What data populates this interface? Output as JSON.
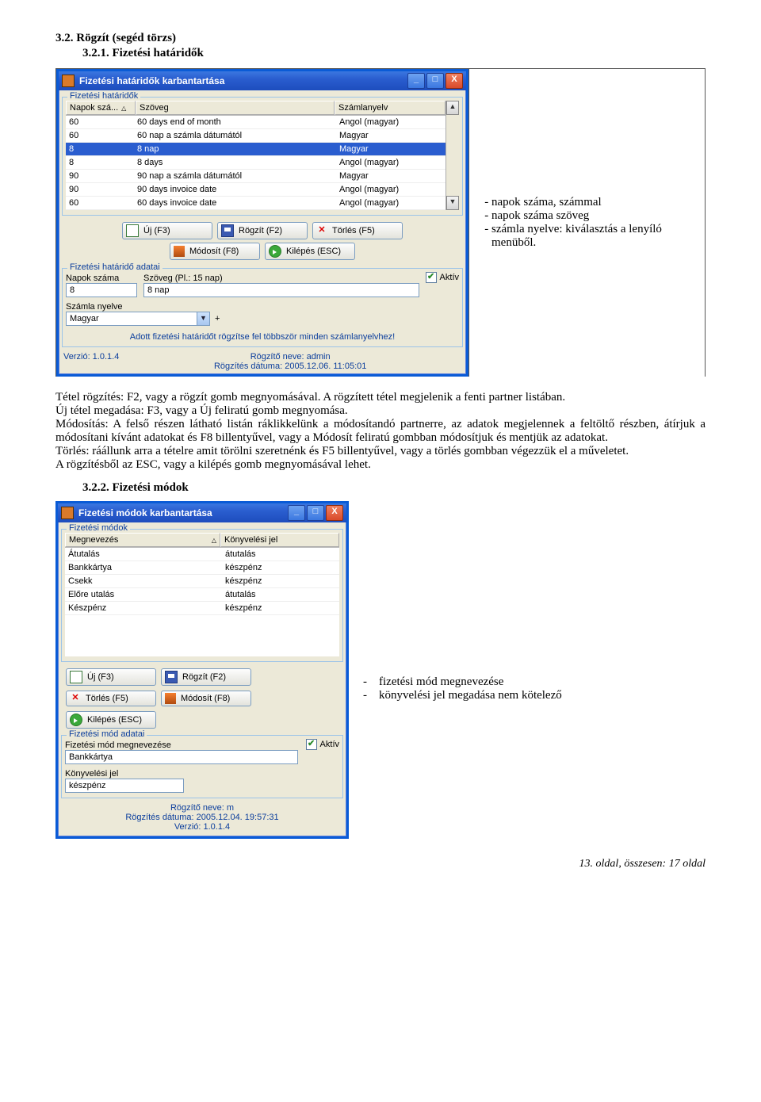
{
  "headings": {
    "h1": "3.2. Rögzít (segéd törzs)",
    "h2": "3.2.1. Fizetési határidők",
    "h3": "3.2.2. Fizetési módok"
  },
  "win1": {
    "title": "Fizetési határidők karbantartása",
    "group1": "Fizetési határidők",
    "columns": {
      "c1": "Napok szá...",
      "c2": "Szöveg",
      "c3": "Számlanyelv"
    },
    "rows": [
      {
        "c1": "60",
        "c2": "60 days end of month",
        "c3": "Angol (magyar)"
      },
      {
        "c1": "60",
        "c2": "60 nap a számla dátumától",
        "c3": "Magyar"
      },
      {
        "c1": "8",
        "c2": "8 nap",
        "c3": "Magyar",
        "sel": true
      },
      {
        "c1": "8",
        "c2": "8 days",
        "c3": "Angol (magyar)"
      },
      {
        "c1": "90",
        "c2": "90 nap a számla dátumától",
        "c3": "Magyar"
      },
      {
        "c1": "90",
        "c2": "90 days invoice date",
        "c3": "Angol (magyar)"
      },
      {
        "c1": "60",
        "c2": "60 days invoice date",
        "c3": "Angol (magyar)"
      }
    ],
    "buttons": {
      "new": "Új (F3)",
      "save": "Rögzít (F2)",
      "del": "Törlés (F5)",
      "edit": "Módosít (F8)",
      "exit": "Kilépés (ESC)"
    },
    "group2": "Fizetési határidő adatai",
    "labels": {
      "napok": "Napok száma",
      "szoveg": "Szöveg",
      "szoveg_hint": "(Pl.: 15 nap)",
      "aktiv": "Aktív",
      "nyelv": "Számla nyelve"
    },
    "values": {
      "napok": "8",
      "szoveg": "8 nap",
      "nyelv": "Magyar",
      "plus": "+"
    },
    "note": "Adott fizetési határidőt rögzítse fel többször minden számlanyelvhez!",
    "status": {
      "version": "Verzió: 1.0.1.4",
      "user": "Rögzítő neve: admin",
      "date": "Rögzítés dátuma: 2005.12.06. 11:05:01"
    }
  },
  "side1": {
    "i1": "napok száma, számmal",
    "i2": "napok száma szöveg",
    "i3": "számla nyelve: kiválasztás a lenyíló menüből."
  },
  "para": {
    "p1": "Tétel rögzítés: F2, vagy a rögzít gomb megnyomásával. A rögzített tétel megjelenik a fenti partner listában.",
    "p2": "Új tétel megadása: F3, vagy a Új feliratú gomb megnyomása.",
    "p3": "Módosítás: A felső részen látható listán ráklikkelünk a módosítandó partnerre, az adatok megjelennek a feltöltő részben, átírjuk a módosítani kívánt adatokat és F8 billentyűvel, vagy a Módosít feliratú gombban módosítjuk és mentjük az adatokat.",
    "p4": "Törlés: ráállunk arra a tételre amit törölni szeretnénk és F5 billentyűvel, vagy a törlés gombban végezzük el a műveletet.",
    "p5": "A rögzítésből az ESC, vagy a kilépés gomb megnyomásával lehet."
  },
  "win2": {
    "title": "Fizetési módok karbantartása",
    "group1": "Fizetési módok",
    "columns": {
      "c1": "Megnevezés",
      "c2": "Könyvelési jel"
    },
    "rows": [
      {
        "c1": "Átutalás",
        "c2": "átutalás"
      },
      {
        "c1": "Bankkártya",
        "c2": "készpénz"
      },
      {
        "c1": "Csekk",
        "c2": "készpénz"
      },
      {
        "c1": "Előre utalás",
        "c2": "átutalás"
      },
      {
        "c1": "Készpénz",
        "c2": "készpénz"
      }
    ],
    "buttons": {
      "new": "Új (F3)",
      "save": "Rögzít (F2)",
      "del": "Törlés (F5)",
      "edit": "Módosít (F8)",
      "exit": "Kilépés (ESC)"
    },
    "group2": "Fizetési mód adatai",
    "labels": {
      "megnev": "Fizetési mód megnevezése",
      "aktiv": "Aktív",
      "kjel": "Könyvelési jel"
    },
    "values": {
      "megnev": "Bankkártya",
      "kjel": "készpénz"
    },
    "status": {
      "user": "Rögzítő neve: m",
      "date": "Rögzítés dátuma: 2005.12.04. 19:57:31",
      "version": "Verzió: 1.0.1.4"
    }
  },
  "side2": {
    "i1": "fizetési mód megnevezése",
    "i2": "könyvelési jel megadása nem kötelező"
  },
  "footer": "13. oldal, összesen: 17 oldal"
}
